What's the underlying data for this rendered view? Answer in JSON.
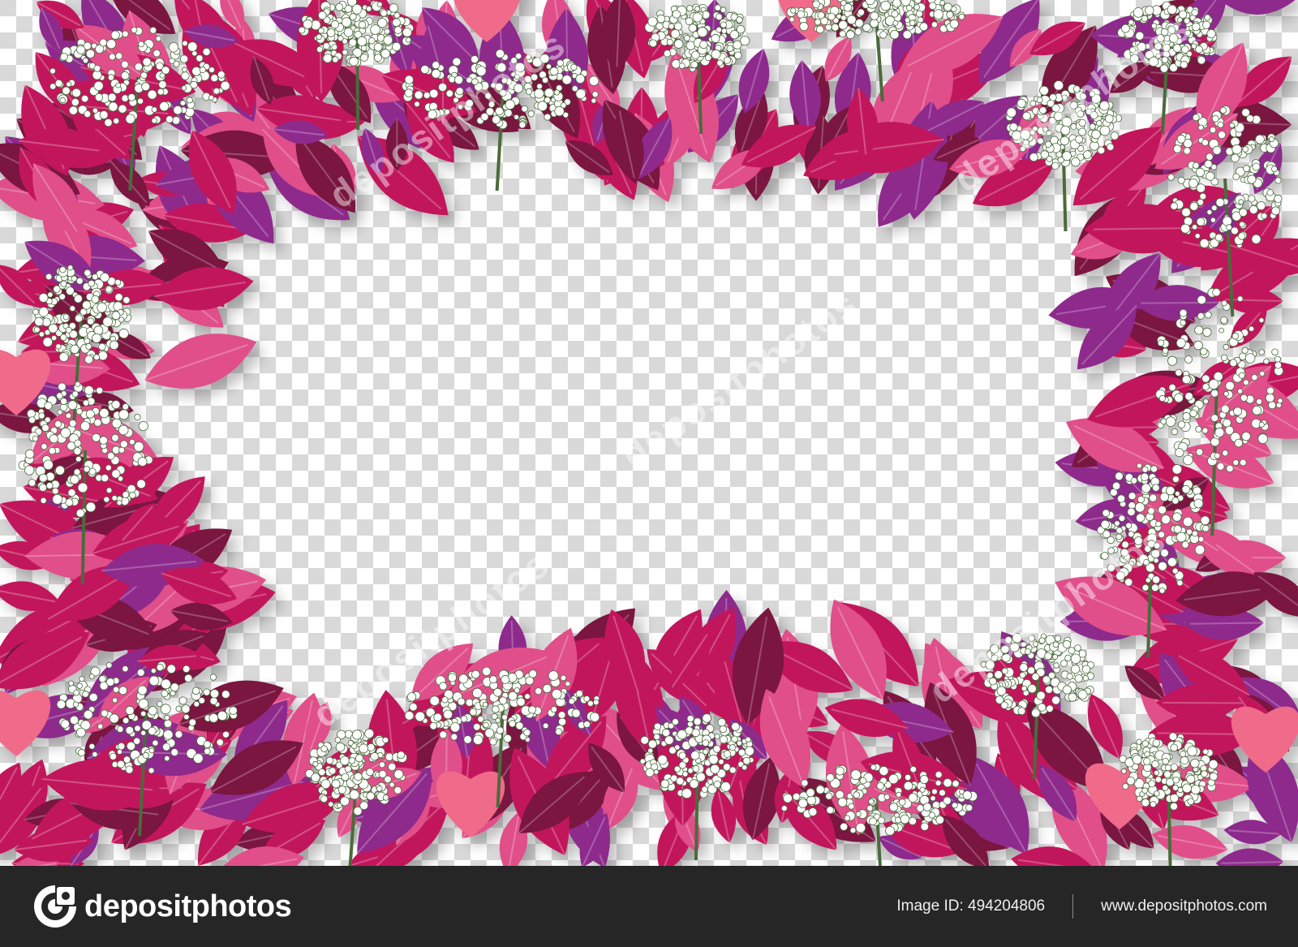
{
  "artwork": {
    "subject": "pink leaves and white flower frame on transparent checkerboard background",
    "colors": {
      "leaf_dark": "#7a1240",
      "leaf_mid": "#c2185b",
      "leaf_light": "#e04f8a",
      "leaf_purple": "#8e2a8c",
      "heart_pink": "#f06a8a",
      "flower_white": "#ffffff",
      "stem_green": "#4a6b3a",
      "checker_light": "#ffffff",
      "checker_dark": "#d9d9d9"
    },
    "watermark": "depositphotos"
  },
  "footer": {
    "background": "#262626",
    "logo_text": "depositphotos",
    "logo_icon": "camera-aperture-icon",
    "image_id": "Image ID: 494204806",
    "website": "www.depositphotos.com"
  }
}
